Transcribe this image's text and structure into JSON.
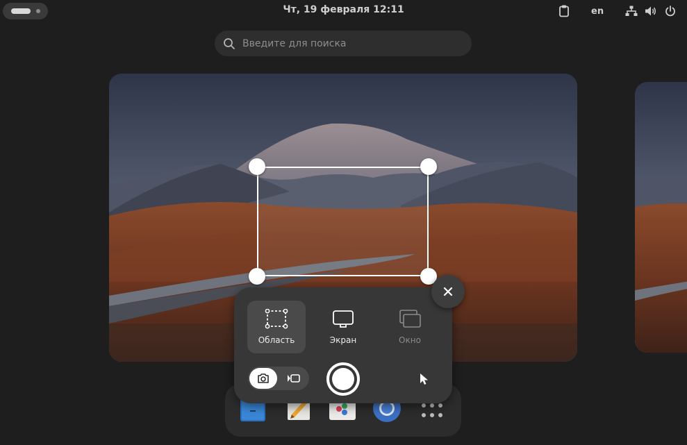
{
  "topbar": {
    "datetime": "Чт, 19 февраля  12:11",
    "language": "en",
    "icons": [
      "clipboard-icon",
      "network-icon",
      "volume-icon",
      "power-icon"
    ]
  },
  "search": {
    "placeholder": "Введите для поиска"
  },
  "screenshot_ui": {
    "modes": [
      {
        "label": "Область",
        "icon": "area-select-icon",
        "state": "selected"
      },
      {
        "label": "Экран",
        "icon": "screen-icon",
        "state": "normal"
      },
      {
        "label": "Окно",
        "icon": "window-icon",
        "state": "disabled"
      }
    ],
    "capture_type": {
      "options": [
        "screenshot",
        "screencast"
      ],
      "selected": "screenshot"
    },
    "shutter": "capture-button",
    "show_pointer": "pointer-icon",
    "close": "close-icon"
  },
  "dock": {
    "apps": [
      "files-icon",
      "text-editor-icon",
      "software-icon",
      "chromium-icon",
      "show-apps-icon"
    ]
  },
  "colors": {
    "background": "#1e1e1e",
    "panel": "#373737",
    "selected_mode": "#4a4a4a",
    "accent_white": "#ffffff"
  }
}
